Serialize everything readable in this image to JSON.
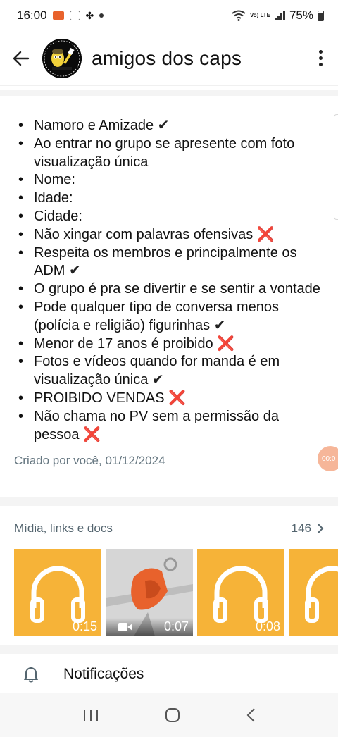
{
  "status_bar": {
    "time": "16:00",
    "battery": "75%",
    "network_label": "Vo) LTE"
  },
  "app_bar": {
    "title": "amigos dos caps",
    "back_icon": "arrow-left-icon",
    "menu_icon": "more-vert-icon"
  },
  "description": {
    "rules": [
      {
        "text": "Namoro e Amizade",
        "mark": "✔"
      },
      {
        "text": "Ao entrar no grupo se apresente com foto visualização única",
        "mark": ""
      },
      {
        "text": "Nome:",
        "mark": ""
      },
      {
        "text": "Idade:",
        "mark": ""
      },
      {
        "text": "Cidade:",
        "mark": ""
      },
      {
        "text": "Não xingar com palavras ofensivas",
        "mark": "❌"
      },
      {
        "text": "Respeita os membros e principalmente os ADM",
        "mark": "✔"
      },
      {
        "text": "O grupo é pra se divertir e se sentir a vontade",
        "mark": ""
      },
      {
        "text": "Pode qualquer tipo de conversa menos (polícia e religião) figurinhas",
        "mark": "✔"
      },
      {
        "text": "Menor de 17 anos é proibido",
        "mark": "❌"
      },
      {
        "text": "Fotos e vídeos quando for manda é em visualização única",
        "mark": "✔"
      },
      {
        "text": "PROIBIDO VENDAS",
        "mark": "❌"
      },
      {
        "text": "Não chama no PV sem a permissão da pessoa",
        "mark": "❌"
      }
    ],
    "created_by": "Criado por você, 01/12/2024"
  },
  "floating_timer": "00:0",
  "media": {
    "title": "Mídia, links e docs",
    "count": "146",
    "items": [
      {
        "type": "audio",
        "duration": "0:15",
        "icon": "headphones-icon"
      },
      {
        "type": "video",
        "duration": "0:07",
        "icon": "video-camera-icon"
      },
      {
        "type": "audio",
        "duration": "0:08",
        "icon": "headphones-icon"
      },
      {
        "type": "audio",
        "duration": "",
        "icon": "headphones-icon"
      }
    ]
  },
  "notifications": {
    "label": "Notificações",
    "icon": "bell-icon"
  },
  "colors": {
    "audio_thumb": "#f6b338",
    "x_mark": "#e03030",
    "secondary_text": "#667781"
  }
}
